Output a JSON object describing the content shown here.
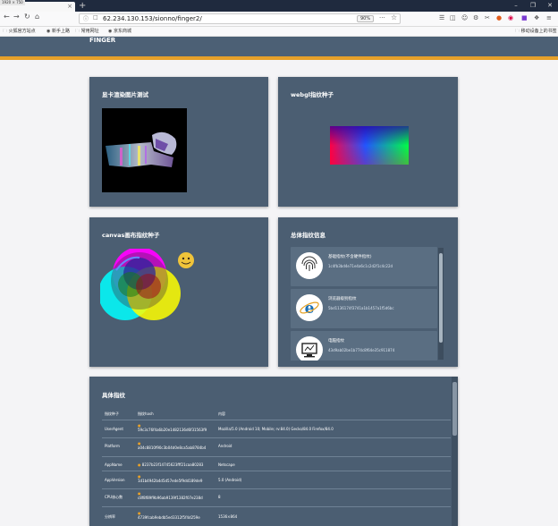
{
  "browser": {
    "dev_badge": "1920 × 750",
    "tab_close": "×",
    "new_tab": "+",
    "url": "62.234.130.153/sionno/finger2/",
    "zoom": "90%",
    "more": "···",
    "bookmarks": [
      "火狐官方站点",
      "新手上路",
      "常用网址",
      "京东商城"
    ],
    "mobile_bookmarks": "移动设备上的书签"
  },
  "header": {
    "title": "FINGER"
  },
  "cards": {
    "gpu": {
      "title": "显卡渲染图片测试"
    },
    "webgl": {
      "title": "webgl指纹种子"
    },
    "canvas": {
      "title": "canvas画布指纹种子"
    },
    "overall": {
      "title": "总体指纹信息"
    }
  },
  "overall_list": [
    {
      "title": "基础指纹(不含硬件指纹)",
      "value": "1c4fb3bd4e71e4a6c1c2d2f1c4c22d",
      "icon": "fingerprint-icon"
    },
    {
      "title": "浏览器级别指纹",
      "value": "5bd1136174f3741a1b1457a1f5d6bc",
      "icon": "ie-browser-icon"
    },
    {
      "title": "电脑指纹",
      "value": "43d9ab02be1b774c8f64e35c911874",
      "icon": "computer-icon"
    }
  ],
  "details": {
    "title": "具体指纹",
    "columns": [
      "指纹种子",
      "指纹hash",
      "内容"
    ],
    "rows": [
      {
        "seed": "UserAgent",
        "hash": "59c3c76f4a6b20e1482136d6f31563f9",
        "content": "Mozilla/5.0 (Android 10; Mobile; rv:84.0) Gecko/84.0 Firefox/84.0"
      },
      {
        "seed": "Platform",
        "hash": "a04c8810f90c3b04d0e8ca5ab8784b4",
        "content": "Android"
      },
      {
        "seed": "AppName",
        "hash": "8237b23f14745623fff21caa80283",
        "content": "Netscape"
      },
      {
        "seed": "AppVersion",
        "hash": "1d1b4942b4d5d57ede5f9dd189de9",
        "content": "5.0 (Android)"
      },
      {
        "seed": "CPU核心数",
        "hash": "c8f8f89f9b96ab9139f1382f07e238d",
        "content": "8"
      },
      {
        "seed": "分辨率",
        "hash": "4739fcab9ebdb5ed3312f5f4d259e",
        "content": "1536×864"
      }
    ]
  }
}
